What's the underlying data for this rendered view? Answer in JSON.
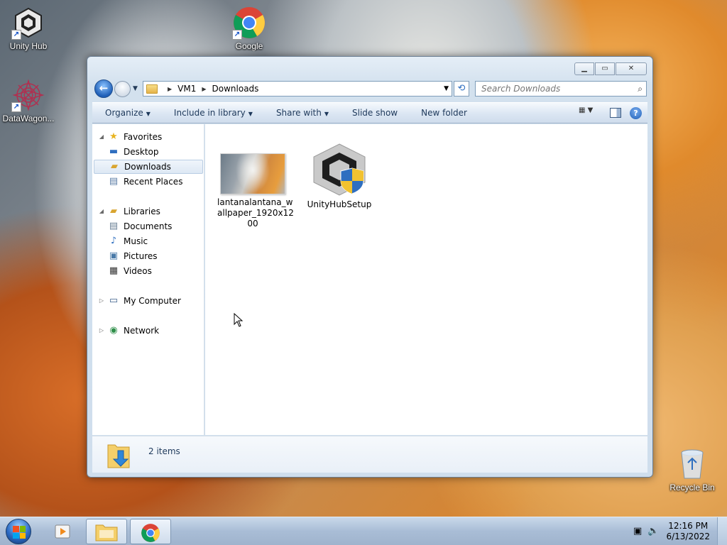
{
  "desktop": {
    "icons": [
      {
        "label": "Unity Hub"
      },
      {
        "label": "Google Chrome"
      },
      {
        "label": "DataWagon..."
      },
      {
        "label": "Recycle Bin"
      }
    ]
  },
  "window": {
    "address": {
      "segments": [
        "VM1",
        "Downloads"
      ]
    },
    "search": {
      "placeholder": "Search Downloads"
    },
    "toolbar": {
      "organize": "Organize",
      "include_in_library": "Include in library",
      "share_with": "Share with",
      "slide_show": "Slide show",
      "new_folder": "New folder"
    },
    "nav": {
      "favorites": "Favorites",
      "desktop": "Desktop",
      "downloads": "Downloads",
      "recent_places": "Recent Places",
      "libraries": "Libraries",
      "documents": "Documents",
      "music": "Music",
      "pictures": "Pictures",
      "videos": "Videos",
      "my_computer": "My Computer",
      "network": "Network"
    },
    "files": [
      {
        "name": "lantanalantana_wallpaper_1920x1200",
        "line1": "lantanalantana_w",
        "line2": "allpaper_1920x12",
        "line3": "00"
      },
      {
        "name": "UnityHubSetup"
      }
    ],
    "details": {
      "count": "2 items"
    }
  },
  "taskbar": {
    "clock_time": "12:16 PM",
    "clock_date": "6/13/2022"
  },
  "colors": {
    "accent": "#1f5fb7",
    "toolbar_text": "#1e395b",
    "selection": "#dde8f4"
  }
}
